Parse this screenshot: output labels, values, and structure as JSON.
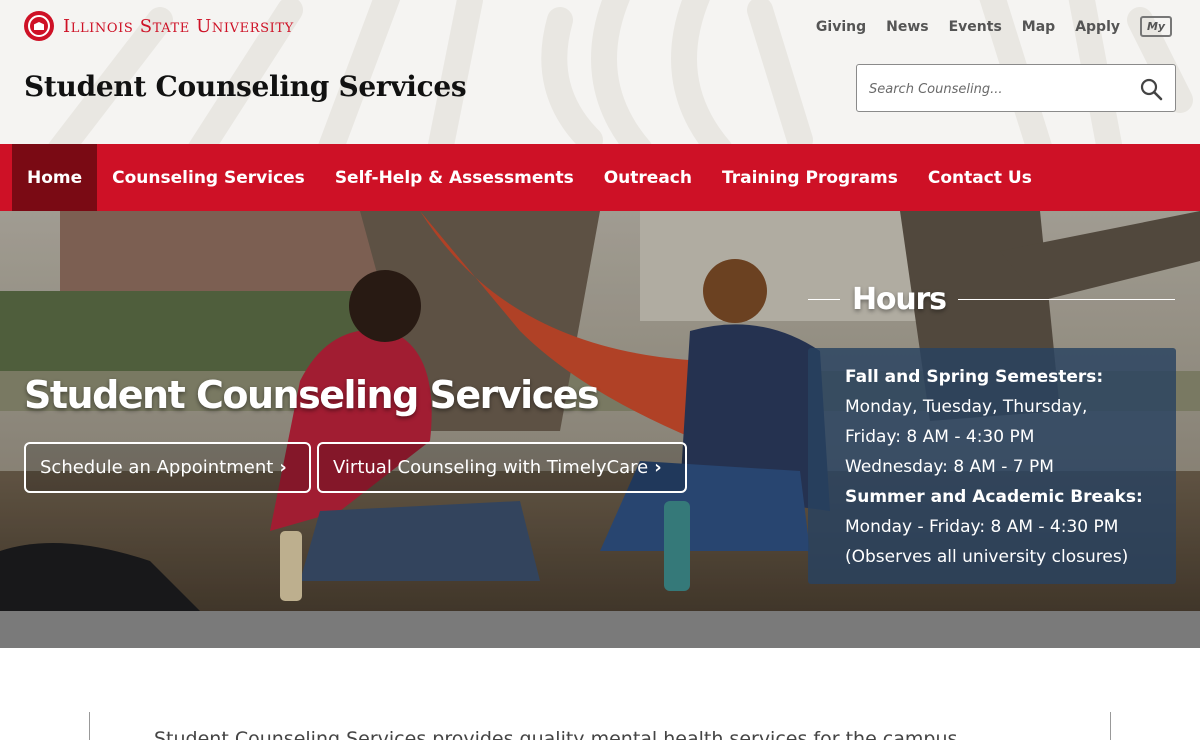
{
  "brand": {
    "name": "Illinois State University",
    "seal_icon": "university-seal-icon"
  },
  "utility_nav": {
    "items": [
      "Giving",
      "News",
      "Events",
      "Map",
      "Apply"
    ],
    "my_label": "My"
  },
  "site_title": "Student Counseling Services",
  "search": {
    "placeholder": "Search Counseling...",
    "icon": "search-icon"
  },
  "main_nav": {
    "items": [
      {
        "label": "Home",
        "active": true
      },
      {
        "label": "Counseling Services",
        "active": false
      },
      {
        "label": "Self-Help & Assessments",
        "active": false
      },
      {
        "label": "Outreach",
        "active": false
      },
      {
        "label": "Training Programs",
        "active": false
      },
      {
        "label": "Contact Us",
        "active": false
      }
    ]
  },
  "hero": {
    "title": "Student Counseling Services",
    "buttons": [
      {
        "label": "Schedule an Appointment",
        "icon": "chevron-right-icon"
      },
      {
        "label": "Virtual Counseling with TimelyCare",
        "icon": "chevron-right-icon"
      }
    ],
    "hours": {
      "heading": "Hours",
      "lines": [
        {
          "text": "Fall and Spring Semesters:",
          "bold": true
        },
        {
          "text": "Monday, Tuesday, Thursday,",
          "bold": false
        },
        {
          "text": "Friday: 8 AM - 4:30 PM",
          "bold": false
        },
        {
          "text": "Wednesday: 8 AM - 7 PM",
          "bold": false
        },
        {
          "text": "Summer and Academic Breaks:",
          "bold": true
        },
        {
          "text": "Monday - Friday: 8 AM - 4:30 PM",
          "bold": false
        },
        {
          "text": "(Observes all university closures)",
          "bold": false
        }
      ]
    }
  },
  "intro": {
    "text": "Student Counseling Services provides quality mental health services for the campus"
  },
  "colors": {
    "brand_red": "#ce1126",
    "nav_active": "#7a0a14",
    "hours_panel": "#284260",
    "gray_band": "#7a7a7a"
  }
}
